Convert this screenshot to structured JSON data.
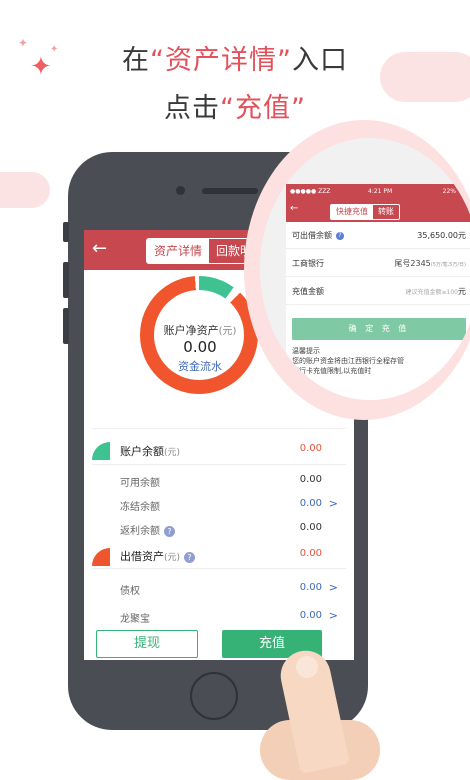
{
  "headline": {
    "line1": {
      "pre": "在",
      "accent": "“资产详情”",
      "post": "入口"
    },
    "line2": {
      "pre": "点击",
      "accent": "“充值”"
    }
  },
  "app": {
    "back_icon": "arrow-left-icon",
    "tabs": [
      {
        "label": "资产详情",
        "active": true
      },
      {
        "label": "回款明"
      }
    ],
    "summary": {
      "label": "账户净资产",
      "unit": "(元)",
      "value": "0.00",
      "link": "资金流水"
    },
    "balance": {
      "title": "账户余额",
      "unit": "(元)",
      "value": "0.00",
      "rows": [
        {
          "label": "可用余额",
          "value": "0.00"
        },
        {
          "label": "冻结余额",
          "value": "0.00",
          "chevron": ">"
        },
        {
          "label": "返利余额",
          "value": "0.00"
        }
      ]
    },
    "lending": {
      "title": "出借资产",
      "unit": "(元)",
      "value": "0.00",
      "rows": [
        {
          "label": "债权",
          "value": "0.00",
          "chevron": ">"
        },
        {
          "label": "龙聚宝",
          "value": "0.00",
          "chevron": ">"
        }
      ]
    },
    "buttons": {
      "withdraw": "提现",
      "recharge": "充值"
    },
    "colors": {
      "header": "#c8484f",
      "green": "#37b277",
      "orange": "#f0552d",
      "teal": "#3fc291"
    }
  },
  "zoom": {
    "status": {
      "carrier": "●●●●● ZZZ",
      "time": "4:21 PM",
      "battery": "22%"
    },
    "tabs": [
      {
        "label": "快捷充值",
        "active": true
      },
      {
        "label": "转账"
      }
    ],
    "rows": [
      {
        "label": "可出借余额",
        "value": "35,650.00元"
      },
      {
        "label": "工商银行",
        "value": "尾号2345",
        "note": "(5万/笔,5万/日)"
      },
      {
        "label": "充值金额",
        "placeholder": "建议充值金额≥100",
        "unit": "元"
      }
    ],
    "confirm": "确 定 充 值",
    "tip_title": "温馨提示",
    "tip_text": "您的账户资金将由江西银行全程存管",
    "tip_text2": "银行卡充值限制,以充值时"
  }
}
